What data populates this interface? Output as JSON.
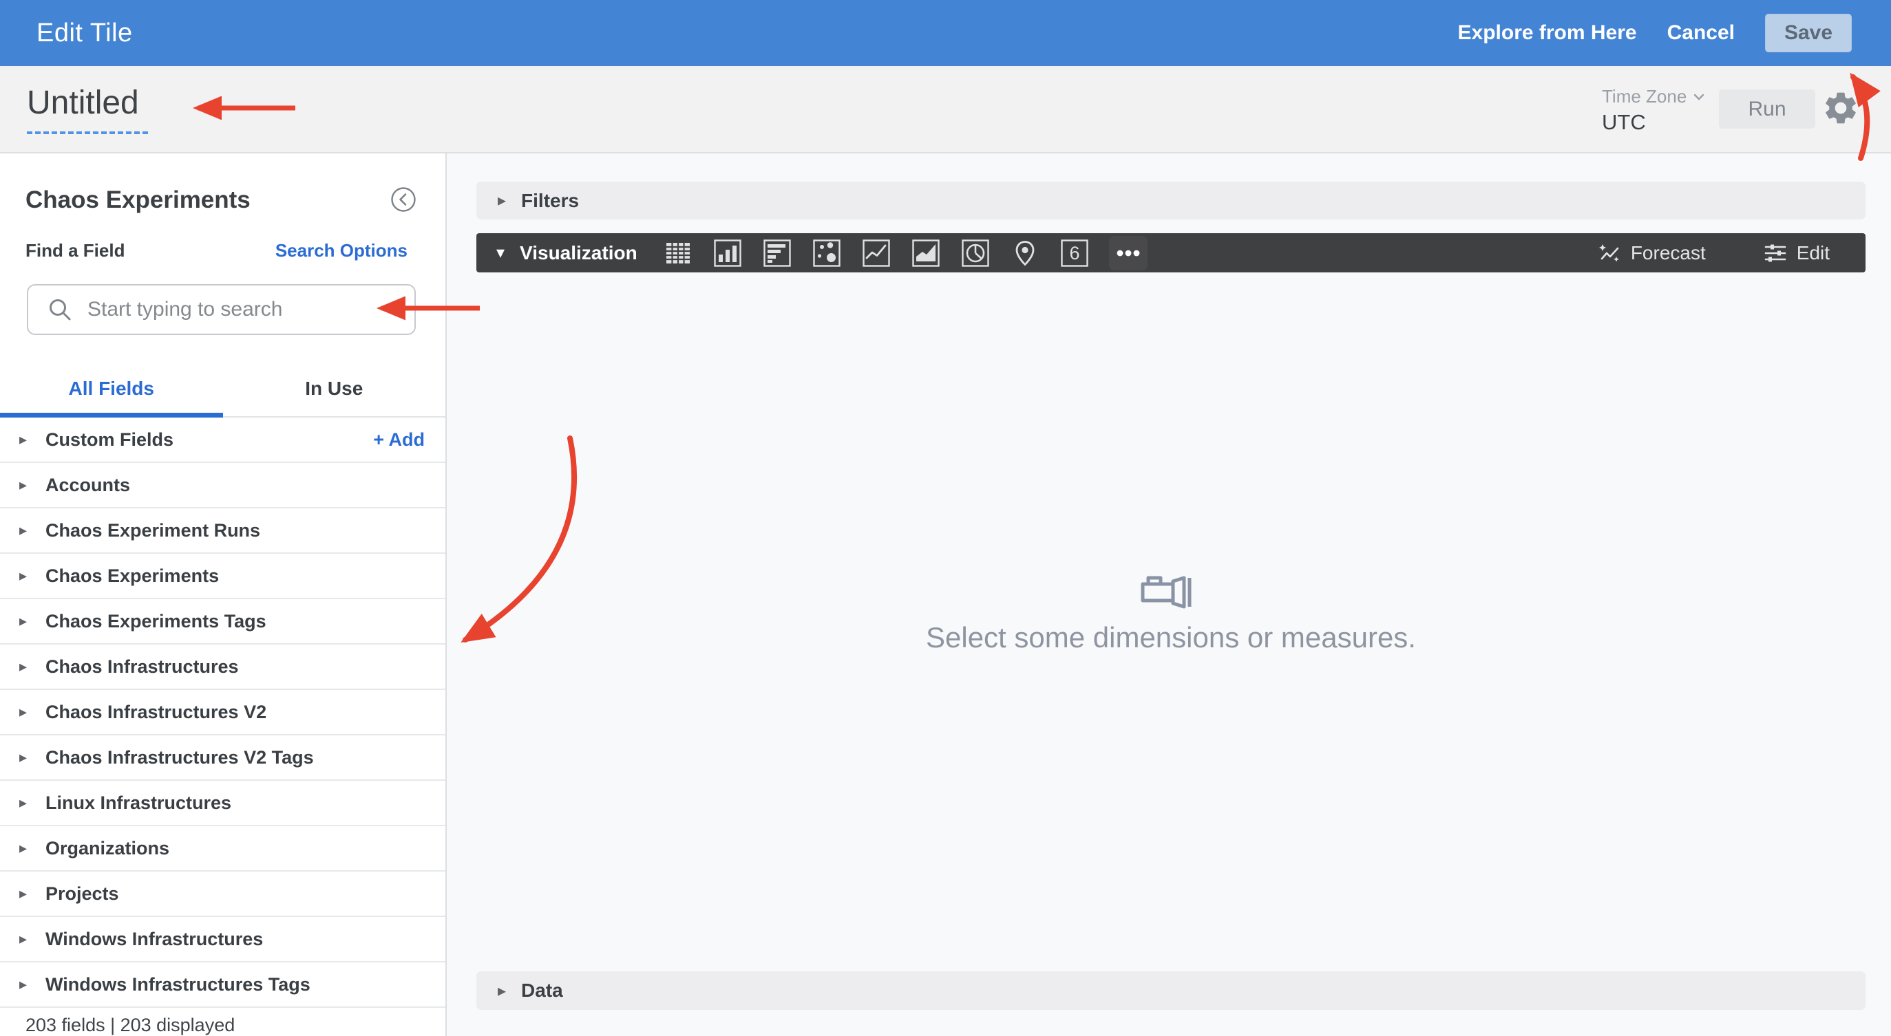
{
  "colors": {
    "header_blue": "#4484d4",
    "accent_blue": "#2b6cd4",
    "annotation_red": "#e7432e",
    "viz_bar_dark": "#3f4042",
    "empty_state_gray": "#8e95a1",
    "save_button_bg": "#bad0e9"
  },
  "icons": {
    "caret_right": "▸",
    "caret_down": "▾"
  },
  "top_bar": {
    "title": "Edit Tile",
    "explore_label": "Explore from Here",
    "cancel_label": "Cancel",
    "save_label": "Save"
  },
  "title_bar": {
    "title": "Untitled",
    "timezone_label": "Time Zone",
    "timezone_value": "UTC",
    "run_label": "Run"
  },
  "sidebar": {
    "heading": "Chaos Experiments",
    "find_label": "Find a Field",
    "search_options_label": "Search Options",
    "search_placeholder": "Start typing to search",
    "tabs": [
      {
        "label": "All Fields",
        "active": true
      },
      {
        "label": "In Use",
        "active": false
      }
    ],
    "add_label": "+ Add",
    "fields": [
      {
        "label": "Custom Fields"
      },
      {
        "label": "Accounts"
      },
      {
        "label": "Chaos Experiment Runs"
      },
      {
        "label": "Chaos Experiments"
      },
      {
        "label": "Chaos Experiments Tags"
      },
      {
        "label": "Chaos Infrastructures"
      },
      {
        "label": "Chaos Infrastructures V2"
      },
      {
        "label": "Chaos Infrastructures V2 Tags"
      },
      {
        "label": "Linux Infrastructures"
      },
      {
        "label": "Organizations"
      },
      {
        "label": "Projects"
      },
      {
        "label": "Windows Infrastructures"
      },
      {
        "label": "Windows Infrastructures Tags"
      }
    ],
    "footer": "203 fields | 203 displayed"
  },
  "main": {
    "filters": {
      "label": "Filters"
    },
    "visualization": {
      "label": "Visualization",
      "icons": [
        "table",
        "column",
        "bar",
        "scatter",
        "line",
        "area",
        "pie",
        "map",
        "single-value",
        "more"
      ],
      "single_value_glyph": "6",
      "forecast_label": "Forecast",
      "edit_label": "Edit"
    },
    "empty_state": {
      "message": "Select some dimensions or measures."
    },
    "data": {
      "label": "Data"
    }
  }
}
